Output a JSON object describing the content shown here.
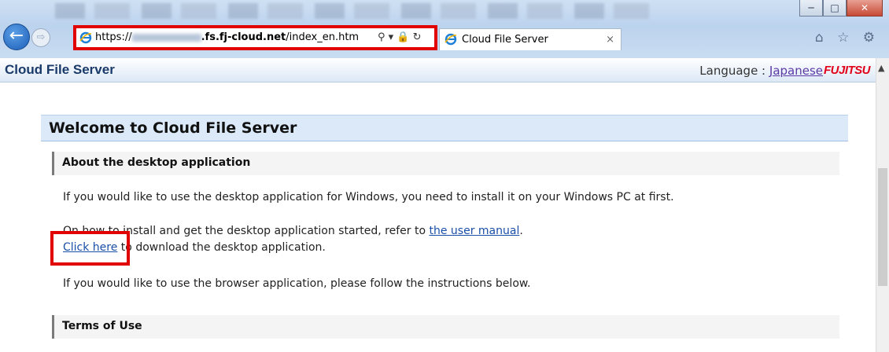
{
  "browser": {
    "url_prefix": "https://",
    "url_domain": ".fs.fj-cloud.net",
    "url_path": "/index_en.htm",
    "tab_title": "Cloud File Server",
    "back_glyph": "←",
    "fwd_glyph": "⇨",
    "addr_icons": "⚲ ▾ 🔒 ↻",
    "tab_close": "×",
    "right_icons": "⌂ ☆ ⚙",
    "win_min": "─",
    "win_max": "□",
    "win_close": "✕"
  },
  "header": {
    "title": "Cloud File Server",
    "language_label": "Language : ",
    "language_link": "Japanese",
    "logo": "FUJITSU"
  },
  "main": {
    "welcome_title": "Welcome to Cloud File Server",
    "section_desktop": "About the desktop application",
    "para_install": "If you would like to use the desktop application for Windows, you need to install it on your Windows PC at first.",
    "para_howto_prefix": "On how to install and get the desktop application started, refer to ",
    "para_howto_link": "the user manual",
    "para_howto_suffix": ".",
    "click_here_link": "Click here",
    "click_here_suffix": " to download the desktop application.",
    "para_browser": "If you would like to use the browser application, please follow the instructions below.",
    "section_terms": "Terms of Use"
  },
  "colors": {
    "highlight": "#e00000",
    "link": "#1a4fa8",
    "visited_link": "#5b3aa6",
    "fujitsu_red": "#e2001a",
    "welcome_bg": "#dbe9f8"
  }
}
